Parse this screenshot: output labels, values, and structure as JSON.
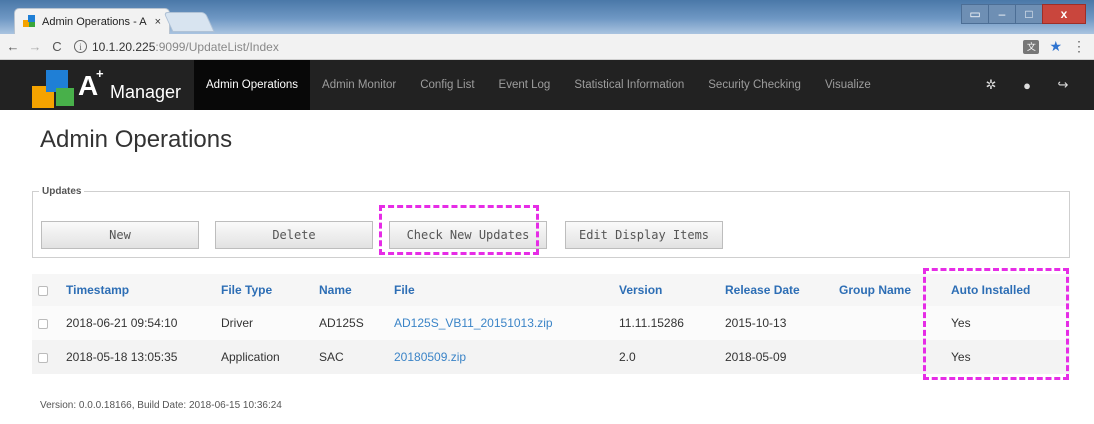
{
  "browser": {
    "tab_title": "Admin Operations - A -",
    "tab_close": "×",
    "url_host": "10.1.20.225",
    "url_rest": ":9099/UpdateList/Index",
    "window_buttons": [
      "▭",
      "–",
      "□",
      "x"
    ]
  },
  "navbar": {
    "logo_letter": "A",
    "logo_plus": "+",
    "logo_text": "Manager",
    "items": [
      {
        "label": "Admin Operations",
        "active": true
      },
      {
        "label": "Admin Monitor"
      },
      {
        "label": "Config List"
      },
      {
        "label": "Event Log"
      },
      {
        "label": "Statistical Information"
      },
      {
        "label": "Security Checking"
      },
      {
        "label": "Visualize"
      }
    ],
    "icons": [
      "gear-icon",
      "user-icon",
      "logout-icon"
    ]
  },
  "page": {
    "title": "Admin Operations",
    "updates_legend": "Updates",
    "buttons": {
      "new": "New",
      "delete": "Delete",
      "check": "Check New Updates",
      "edit": "Edit Display Items"
    }
  },
  "table": {
    "headers": [
      "Timestamp",
      "File Type",
      "Name",
      "File",
      "Version",
      "Release Date",
      "Group Name",
      "Auto Installed"
    ],
    "rows": [
      [
        "2018-06-21 09:54:10",
        "Driver",
        "AD125S",
        "AD125S_VB11_20151013.zip",
        "11.11.15286",
        "2015-10-13",
        "",
        "Yes"
      ],
      [
        "2018-05-18 13:05:35",
        "Application",
        "SAC",
        "20180509.zip",
        "2.0",
        "2018-05-09",
        "",
        "Yes"
      ]
    ]
  },
  "footer": "Version: 0.0.0.18166, Build Date: 2018-06-15 10:36:24",
  "colors": {
    "highlight": "#e62ce6",
    "link": "#2d6eb5",
    "navbar": "#222222"
  }
}
